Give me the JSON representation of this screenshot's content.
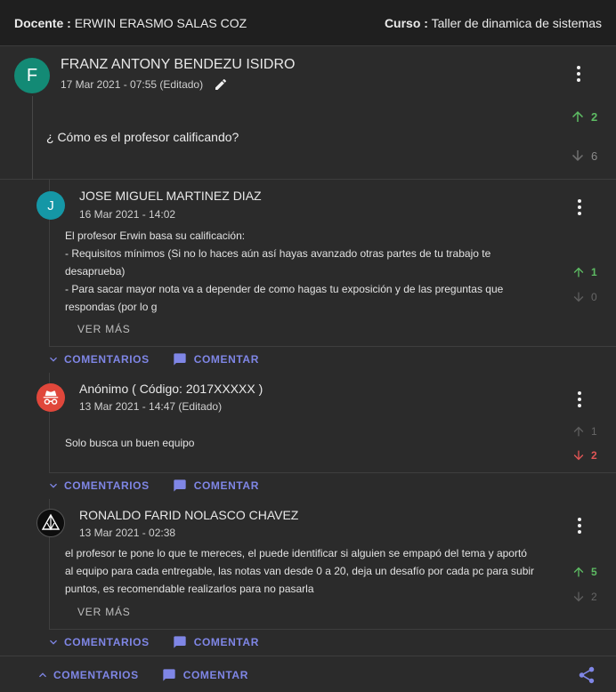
{
  "header": {
    "docente_label": "Docente :",
    "docente_name": "ERWIN ERASMO SALAS COZ",
    "curso_label": "Curso :",
    "curso_name": "Taller de dinamica de sistemas"
  },
  "post": {
    "avatar_letter": "F",
    "author": "FRANZ ANTONY BENDEZU ISIDRO",
    "date": "17 Mar 2021 - 07:55 (Editado)",
    "question": "¿ Cómo es el profesor calificando?",
    "upvotes": "2",
    "downvotes": "6"
  },
  "replies": [
    {
      "avatar_letter": "J",
      "author": "JOSE MIGUEL MARTINEZ DIAZ",
      "date": "16 Mar 2021 - 14:02",
      "lines": [
        "El profesor Erwin basa su calificación:",
        "- Requisitos mínimos (Si no lo haces aún así hayas avanzado otras partes de tu trabajo te",
        "desaprueba)",
        "- Para sacar mayor nota va a depender de como hagas tu exposición y de las preguntas que",
        "respondas (por lo g"
      ],
      "upvotes": "1",
      "downvotes": "0",
      "ver_mas": "VER MÁS"
    },
    {
      "author": "Anónimo ( Código: 2017XXXXX )",
      "date": "13 Mar 2021 - 14:47 (Editado)",
      "lines": [
        "Solo busca un buen equipo"
      ],
      "upvotes": "1",
      "downvotes": "2"
    },
    {
      "author": "RONALDO FARID NOLASCO CHAVEZ",
      "date": "13 Mar 2021 - 02:38",
      "lines": [
        "el profesor te pone lo que te mereces, el puede identificar si alguien se empapó del tema y aportó",
        "al equipo para cada entregable, las notas van desde 0 a 20, deja un desafío por cada pc para subir",
        "puntos, es recomendable realizarlos para no pasarla"
      ],
      "upvotes": "5",
      "downvotes": "2",
      "ver_mas": "VER MÁS"
    }
  ],
  "actions": {
    "comentarios": "COMENTARIOS",
    "comentar": "COMENTAR"
  },
  "colors": {
    "accent": "#7f86e6",
    "upvote": "#5dbb63",
    "downvote_active": "#e05555",
    "avatar_f": "#138a75",
    "avatar_j": "#1597a6",
    "avatar_anon": "#e0473b"
  },
  "icons": [
    "pencil-icon",
    "arrow-up-icon",
    "arrow-down-icon",
    "kebab-menu-icon",
    "chevron-down-icon",
    "chevron-up-icon",
    "comment-icon",
    "share-icon",
    "incognito-icon",
    "linkin-park-logo-icon"
  ]
}
